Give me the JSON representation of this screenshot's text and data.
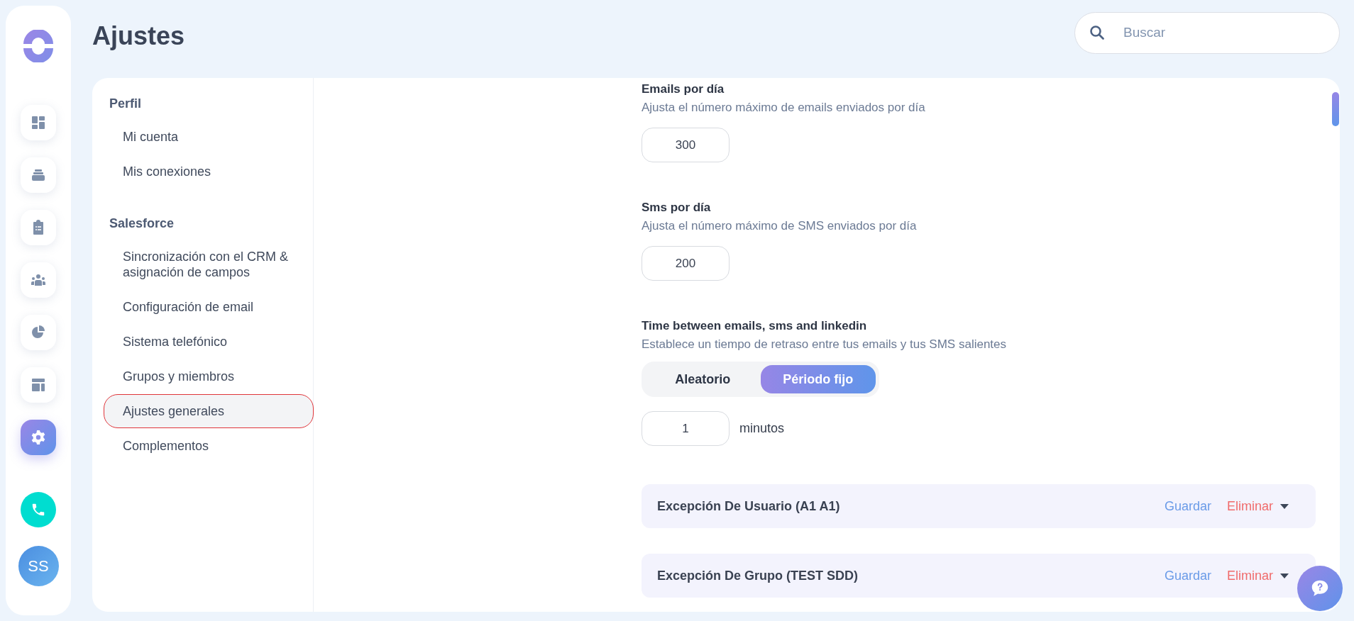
{
  "rail": {
    "items": [
      {
        "kind": "dashboard",
        "selected": false
      },
      {
        "kind": "inbox",
        "selected": false
      },
      {
        "kind": "tasks",
        "selected": false
      },
      {
        "kind": "team",
        "selected": false
      },
      {
        "kind": "reports",
        "selected": false
      },
      {
        "kind": "templates",
        "selected": false
      },
      {
        "kind": "settings",
        "selected": true
      }
    ],
    "avatar": "SS"
  },
  "page_title": "Ajustes",
  "search": {
    "placeholder": "Buscar"
  },
  "menu": [
    {
      "heading": "Perfil",
      "items": [
        {
          "label": "Mi cuenta",
          "selected": false
        },
        {
          "label": "Mis conexiones",
          "selected": false
        }
      ]
    },
    {
      "heading": "Salesforce",
      "items": [
        {
          "label": "Sincronización con el CRM & asignación de campos",
          "selected": false
        },
        {
          "label": "Configuración de email",
          "selected": false
        },
        {
          "label": "Sistema telefónico",
          "selected": false
        },
        {
          "label": "Grupos y miembros",
          "selected": false
        },
        {
          "label": "Ajustes generales",
          "selected": true
        },
        {
          "label": "Complementos",
          "selected": false
        }
      ]
    }
  ],
  "settings": [
    {
      "kind": "number",
      "title": "Emails por día",
      "description": "Ajusta el número máximo de emails enviados por día",
      "value": "300"
    },
    {
      "kind": "number",
      "title": "Sms por día",
      "description": "Ajusta el número máximo de SMS enviados por día",
      "value": "200"
    },
    {
      "kind": "delay",
      "title": "Time between emails, sms and linkedin",
      "description": "Establece un tiempo de retraso entre tus emails y tus SMS salientes",
      "options": [
        {
          "label": "Aleatorio",
          "selected": false
        },
        {
          "label": "Périodo fijo",
          "selected": true
        }
      ],
      "value": "1",
      "unit": "minutos"
    }
  ],
  "exceptions": [
    {
      "title": "Excepción De Usuario (A1 A1)",
      "save": "Guardar",
      "delete": "Eliminar"
    },
    {
      "title": "Excepción De Grupo (TEST SDD)",
      "save": "Guardar",
      "delete": "Eliminar"
    }
  ]
}
